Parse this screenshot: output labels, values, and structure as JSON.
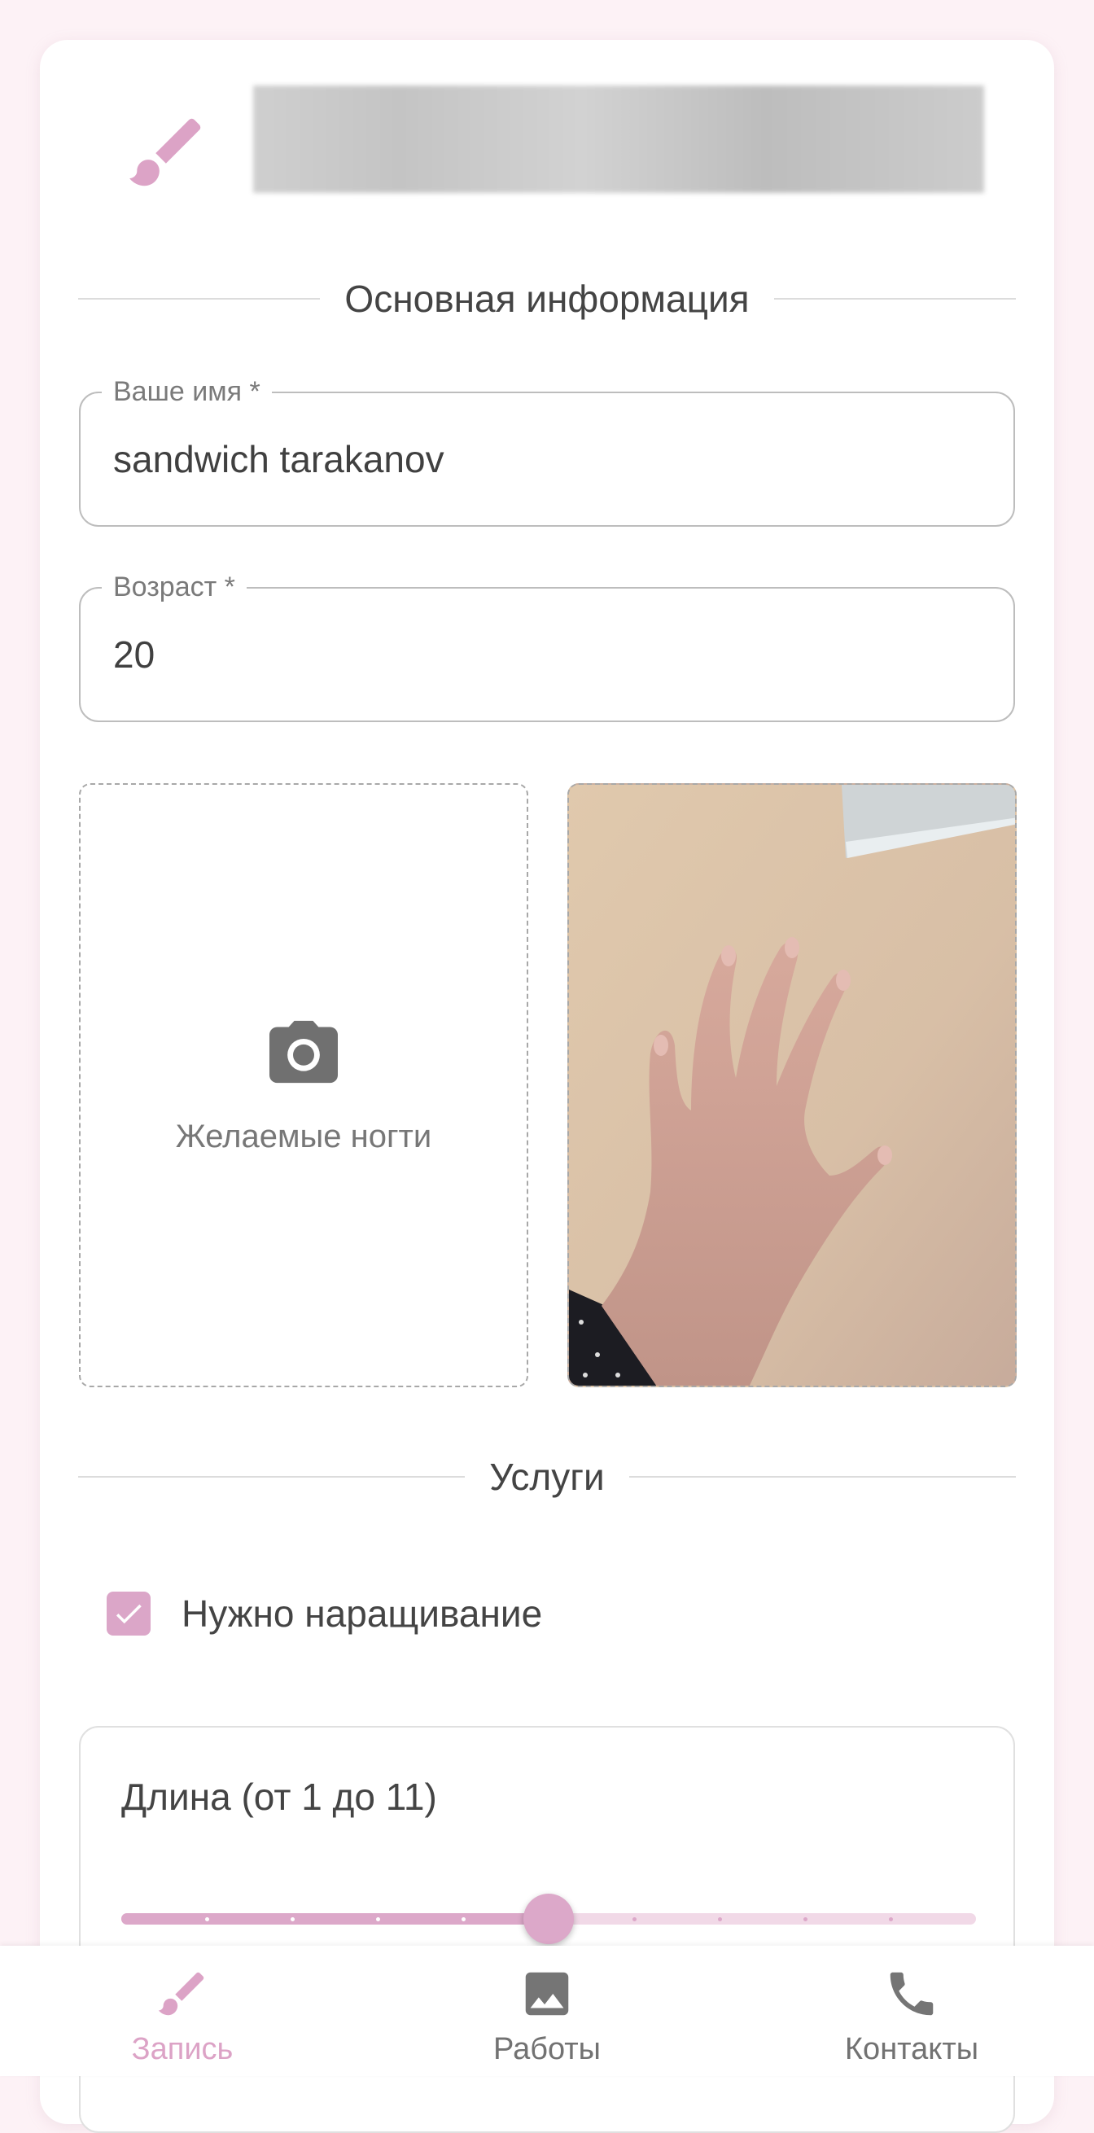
{
  "colors": {
    "accent": "#dca8c9",
    "background": "#fdf2f6",
    "card": "#ffffff"
  },
  "header": {
    "icon": "brush-icon"
  },
  "basic_info": {
    "section_title": "Основная информация",
    "name_label": "Ваше имя *",
    "name_value": "sandwich tarakanov",
    "age_label": "Возраст *",
    "age_value": "20"
  },
  "photos": {
    "desired_caption": "Желаемые ногти",
    "desired_icon": "camera-icon"
  },
  "services": {
    "section_title": "Услуги",
    "extension_label": "Нужно наращивание",
    "extension_checked": true
  },
  "length_slider": {
    "title": "Длина (от 1 до 11)",
    "min": 1,
    "max": 11,
    "value": 6
  },
  "bottom_nav": {
    "items": [
      {
        "label": "Запись",
        "icon": "brush-icon",
        "active": true
      },
      {
        "label": "Работы",
        "icon": "image-icon",
        "active": false
      },
      {
        "label": "Контакты",
        "icon": "phone-icon",
        "active": false
      }
    ]
  }
}
